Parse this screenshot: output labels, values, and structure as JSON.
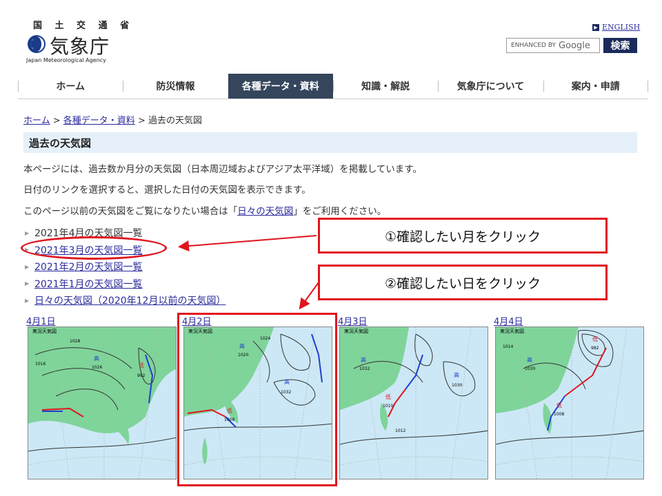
{
  "header": {
    "ministry": "国 土 交 通 省",
    "agency_name": "気象庁",
    "agency_en": "Japan Meteorological Agency",
    "english_link": "ENGLISH",
    "search_placeholder_prefix": "ENHANCED BY",
    "search_placeholder_brand": "Google",
    "search_button": "検索"
  },
  "nav": {
    "items": [
      {
        "label": "ホーム"
      },
      {
        "label": "防災情報"
      },
      {
        "label": "各種データ・資料"
      },
      {
        "label": "知識・解説"
      },
      {
        "label": "気象庁について"
      },
      {
        "label": "案内・申請"
      }
    ],
    "active_index": 2
  },
  "breadcrumb": {
    "home": "ホーム",
    "sep1": " > ",
    "data": "各種データ・資料",
    "sep2": " > ",
    "current": "過去の天気図"
  },
  "page_title": "過去の天気図",
  "paragraphs": {
    "p1": "本ページには、過去数か月分の天気図（日本周辺域およびアジア太平洋域）を掲載しています。",
    "p2": "日付のリンクを選択すると、選択した日付の天気図を表示できます。",
    "p3_before": "このページ以前の天気図をご覧になりたい場合は「",
    "p3_link": "日々の天気図",
    "p3_after": "」をご利用ください。"
  },
  "month_list": [
    {
      "label": "2021年4月の天気図一覧",
      "link": false
    },
    {
      "label": "2021年3月の天気図一覧",
      "link": true
    },
    {
      "label": "2021年2月の天気図一覧",
      "link": true
    },
    {
      "label": "2021年1月の天気図一覧",
      "link": true
    },
    {
      "label": "日々の天気図（2020年12月以前の天気図）",
      "link": true
    }
  ],
  "maps": [
    {
      "date": "4月1日",
      "stamp": "実況天気図",
      "highs": [
        "1026",
        "1028"
      ],
      "lows": [
        "992",
        "1016"
      ]
    },
    {
      "date": "4月2日",
      "stamp": "実況天気図",
      "highs": [
        "1032",
        "1020"
      ],
      "lows": [
        "1008",
        "1024"
      ]
    },
    {
      "date": "4月3日",
      "stamp": "実況天気図",
      "highs": [
        "1030",
        "1032"
      ],
      "lows": [
        "1010",
        "1012"
      ]
    },
    {
      "date": "4月4日",
      "stamp": "実況天気図",
      "highs": [
        "1030",
        "1008"
      ],
      "lows": [
        "1014",
        "982"
      ]
    }
  ],
  "annotations": {
    "step1": "①確認したい月をクリック",
    "step2": "②確認したい日をクリック"
  },
  "colors": {
    "nav_active": "#34455c",
    "heading_bg": "#e5f0fa",
    "link": "#2a2a9c",
    "annotation_red": "#e0141e",
    "land": "#7fd49a",
    "sea": "#cce8f6"
  }
}
